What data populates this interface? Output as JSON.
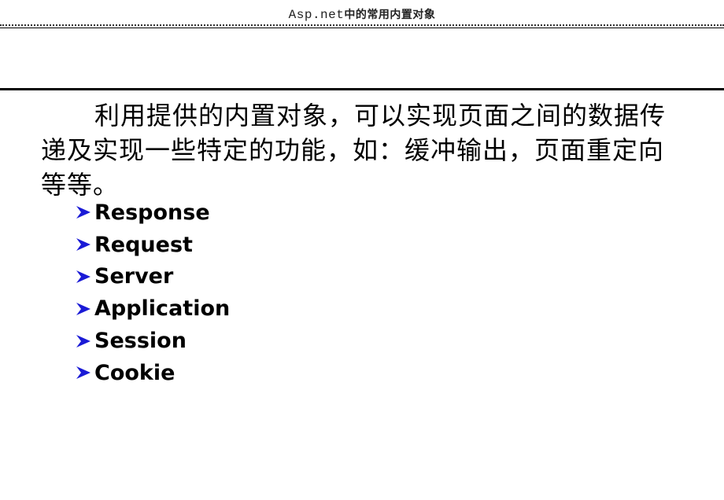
{
  "header": {
    "title_en": "Asp.net",
    "title_cn": "中的常用内置对象"
  },
  "body": {
    "paragraph": "利用提供的内置对象，可以实现页面之间的数据传递及实现一些特定的功能，如：缓冲输出，页面重定向等等。"
  },
  "bullets": {
    "icon": "arrowhead-bullet-icon",
    "color": "#1a1ad6",
    "items": [
      {
        "label": "Response"
      },
      {
        "label": "Request"
      },
      {
        "label": "Server"
      },
      {
        "label": "Application"
      },
      {
        "label": "Session"
      },
      {
        "label": "Cookie"
      }
    ]
  }
}
